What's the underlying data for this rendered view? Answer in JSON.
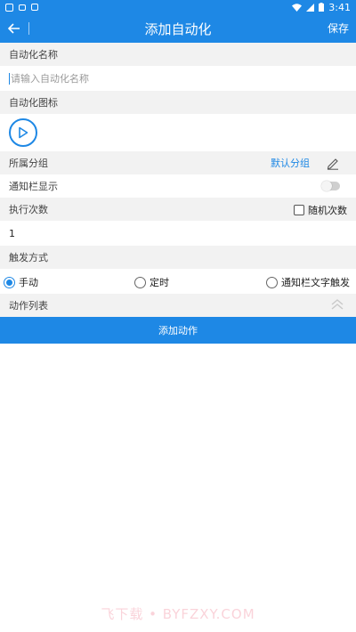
{
  "status_bar": {
    "time": "3:41"
  },
  "app_bar": {
    "title": "添加自动化",
    "save_label": "保存"
  },
  "form": {
    "name_label": "自动化名称",
    "name_placeholder": "请输入自动化名称",
    "name_value": "",
    "icon_label": "自动化图标",
    "group_label": "所属分组",
    "group_value": "默认分组",
    "notify_label": "通知栏显示",
    "notify_enabled": false,
    "exec_label": "执行次数",
    "random_label": "随机次数",
    "random_checked": false,
    "exec_count": "1",
    "trigger_label": "触发方式",
    "trigger_options": [
      {
        "label": "手动",
        "checked": true
      },
      {
        "label": "定时",
        "checked": false
      },
      {
        "label": "通知栏文字触发",
        "checked": false
      }
    ],
    "actions_label": "动作列表",
    "add_action_label": "添加动作"
  },
  "watermark": "飞下载 • BYFZXY.COM",
  "colors": {
    "primary": "#1e88e5",
    "section_bg": "#f2f2f2"
  }
}
